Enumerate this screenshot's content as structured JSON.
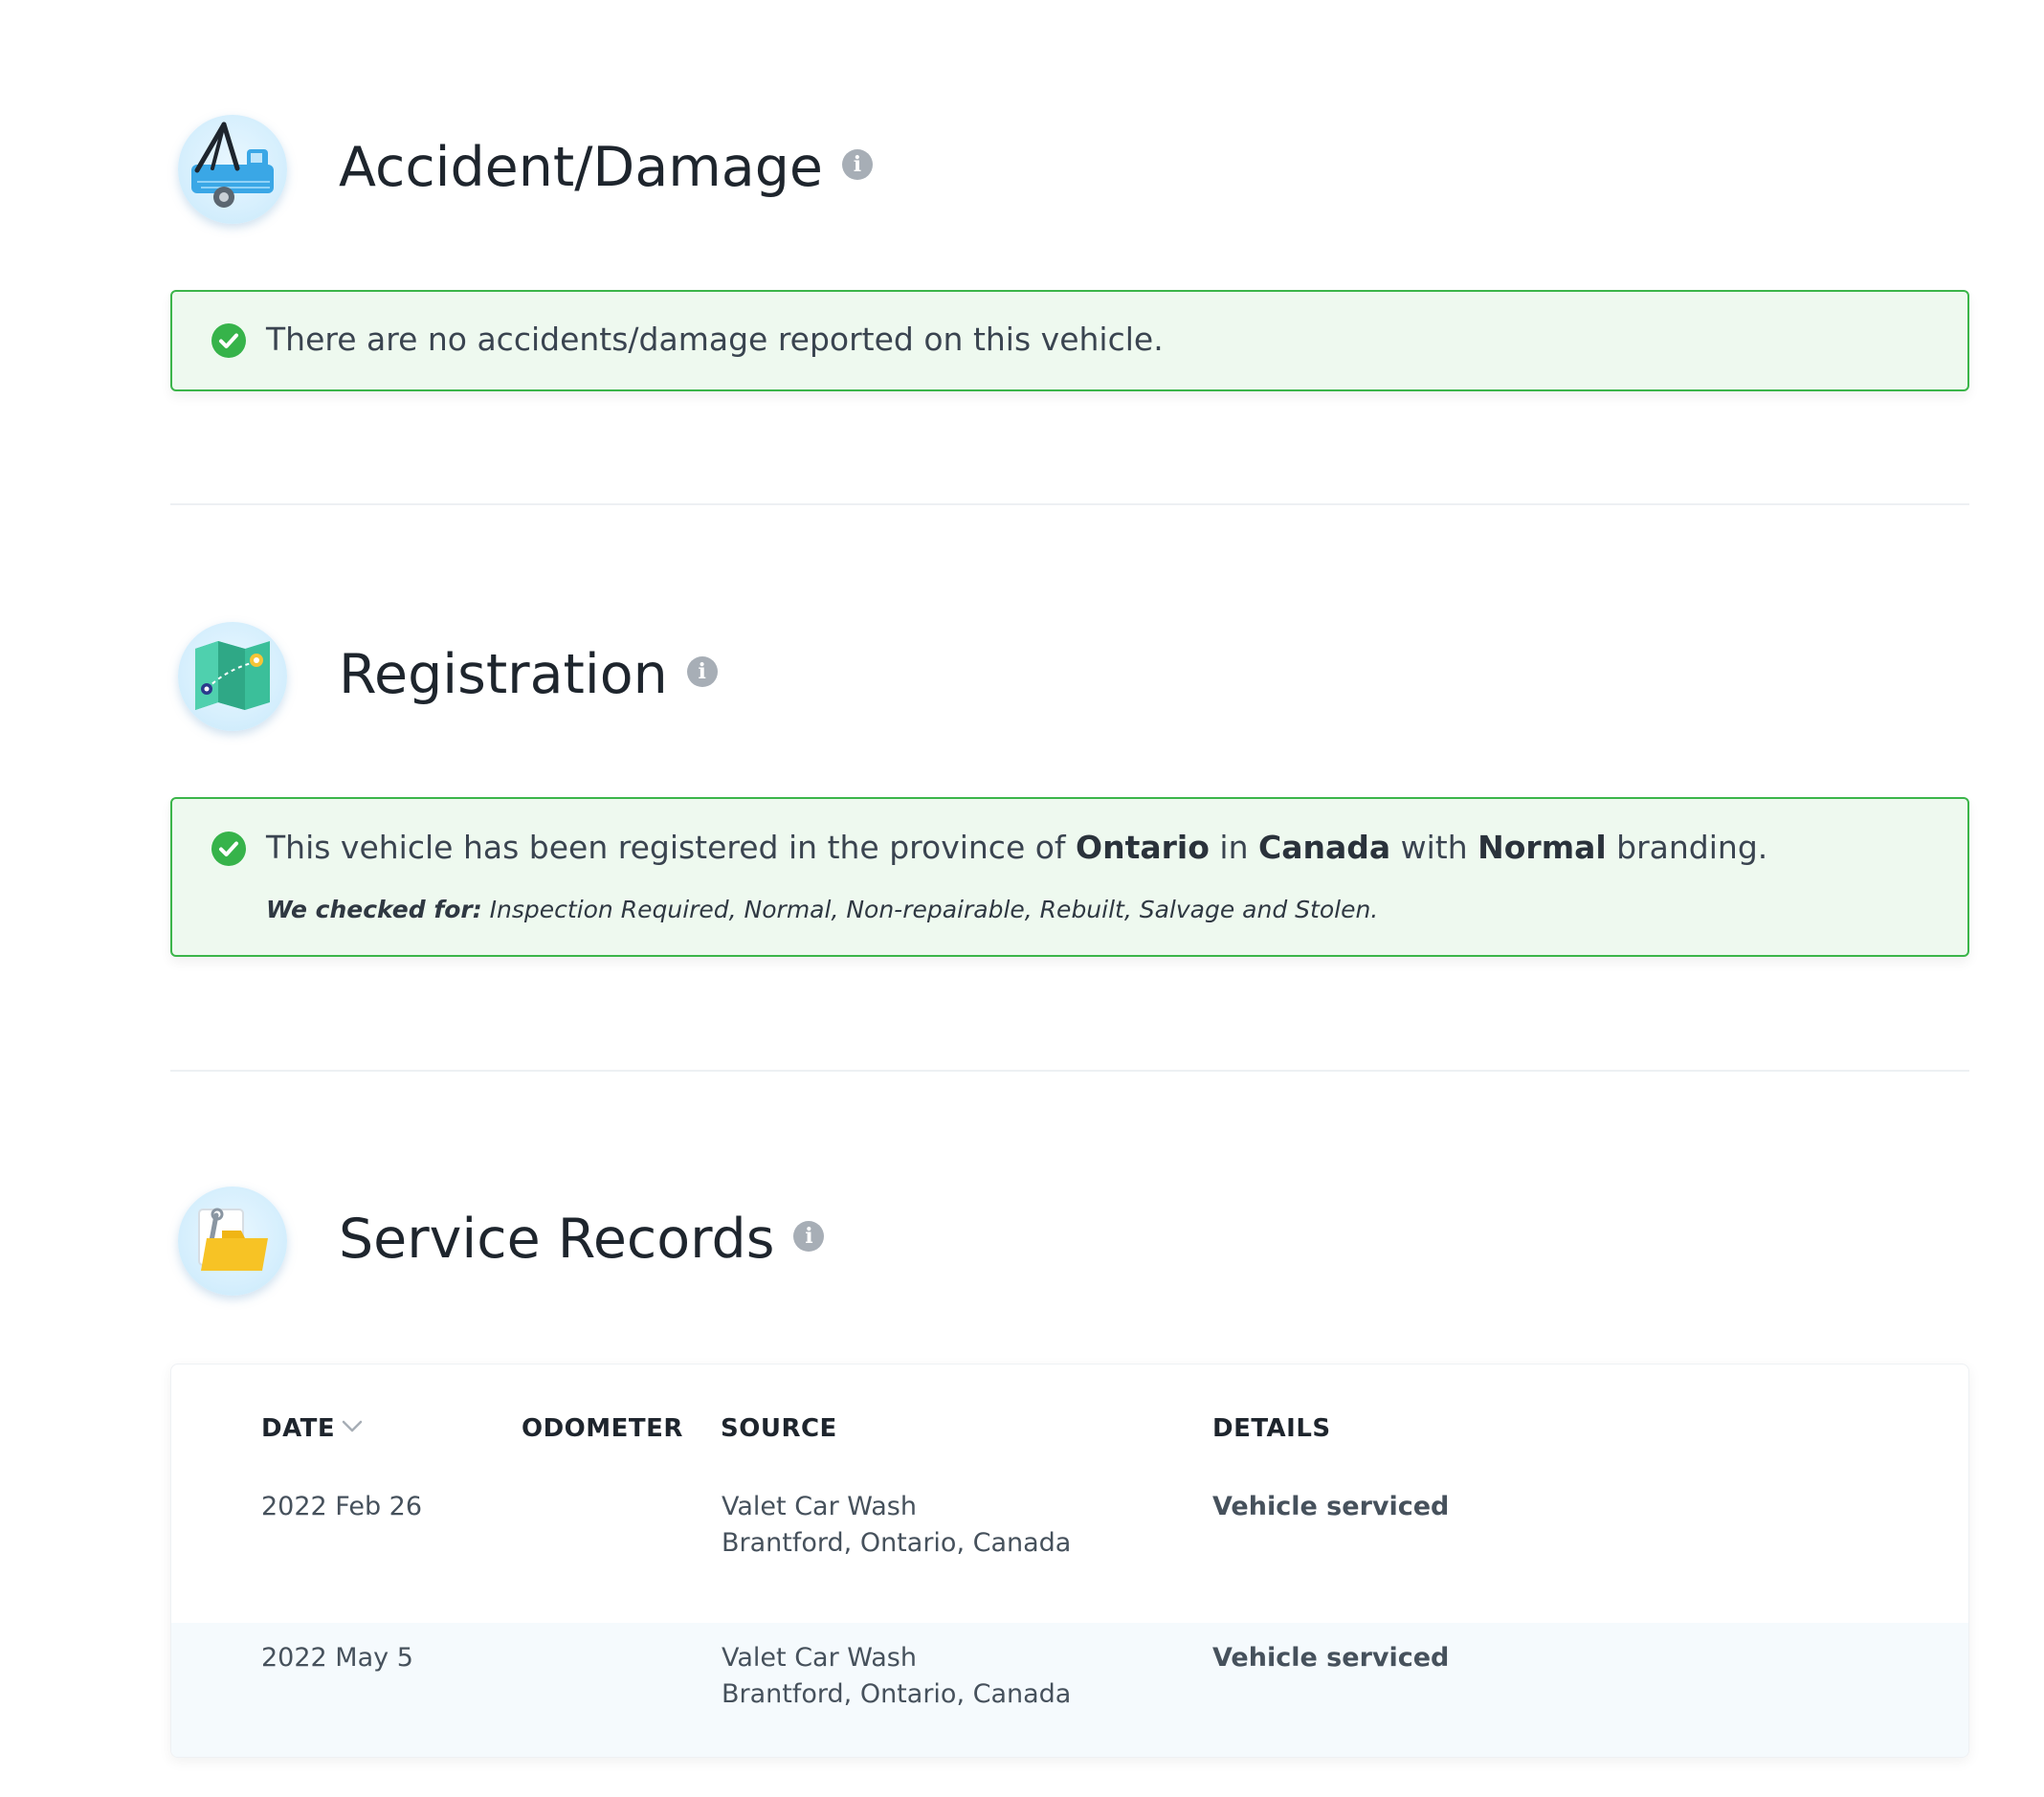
{
  "sections": {
    "accident": {
      "title": "Accident/Damage",
      "icon": "tow-truck-icon",
      "alert_text": "There are no accidents/damage reported on this vehicle."
    },
    "registration": {
      "title": "Registration",
      "icon": "map-icon",
      "alert_pre": "This vehicle has been registered in the province of ",
      "province": "Ontario",
      "alert_mid1": " in ",
      "country": "Canada",
      "alert_mid2": " with ",
      "branding": "Normal",
      "alert_post": " branding.",
      "checked_label": "We checked for:",
      "checked_items": " Inspection Required, Normal, Non-repairable, Rebuilt, Salvage and Stolen."
    },
    "service": {
      "title": "Service Records",
      "icon": "folder-wrench-icon",
      "columns": {
        "date": "DATE",
        "odometer": "ODOMETER",
        "source": "SOURCE",
        "details": "DETAILS"
      },
      "rows": [
        {
          "date": "2022 Feb 26",
          "odometer": "",
          "source_name": "Valet Car Wash",
          "source_location": "Brantford, Ontario, Canada",
          "details": "Vehicle serviced"
        },
        {
          "date": "2022 May 5",
          "odometer": "",
          "source_name": "Valet Car Wash",
          "source_location": "Brantford, Ontario, Canada",
          "details": "Vehicle serviced"
        }
      ]
    }
  },
  "colors": {
    "success_border": "#3bb54a",
    "success_bg": "#eef9ef",
    "info_icon": "#a7aeb6",
    "alt_row": "#f5fafd"
  }
}
